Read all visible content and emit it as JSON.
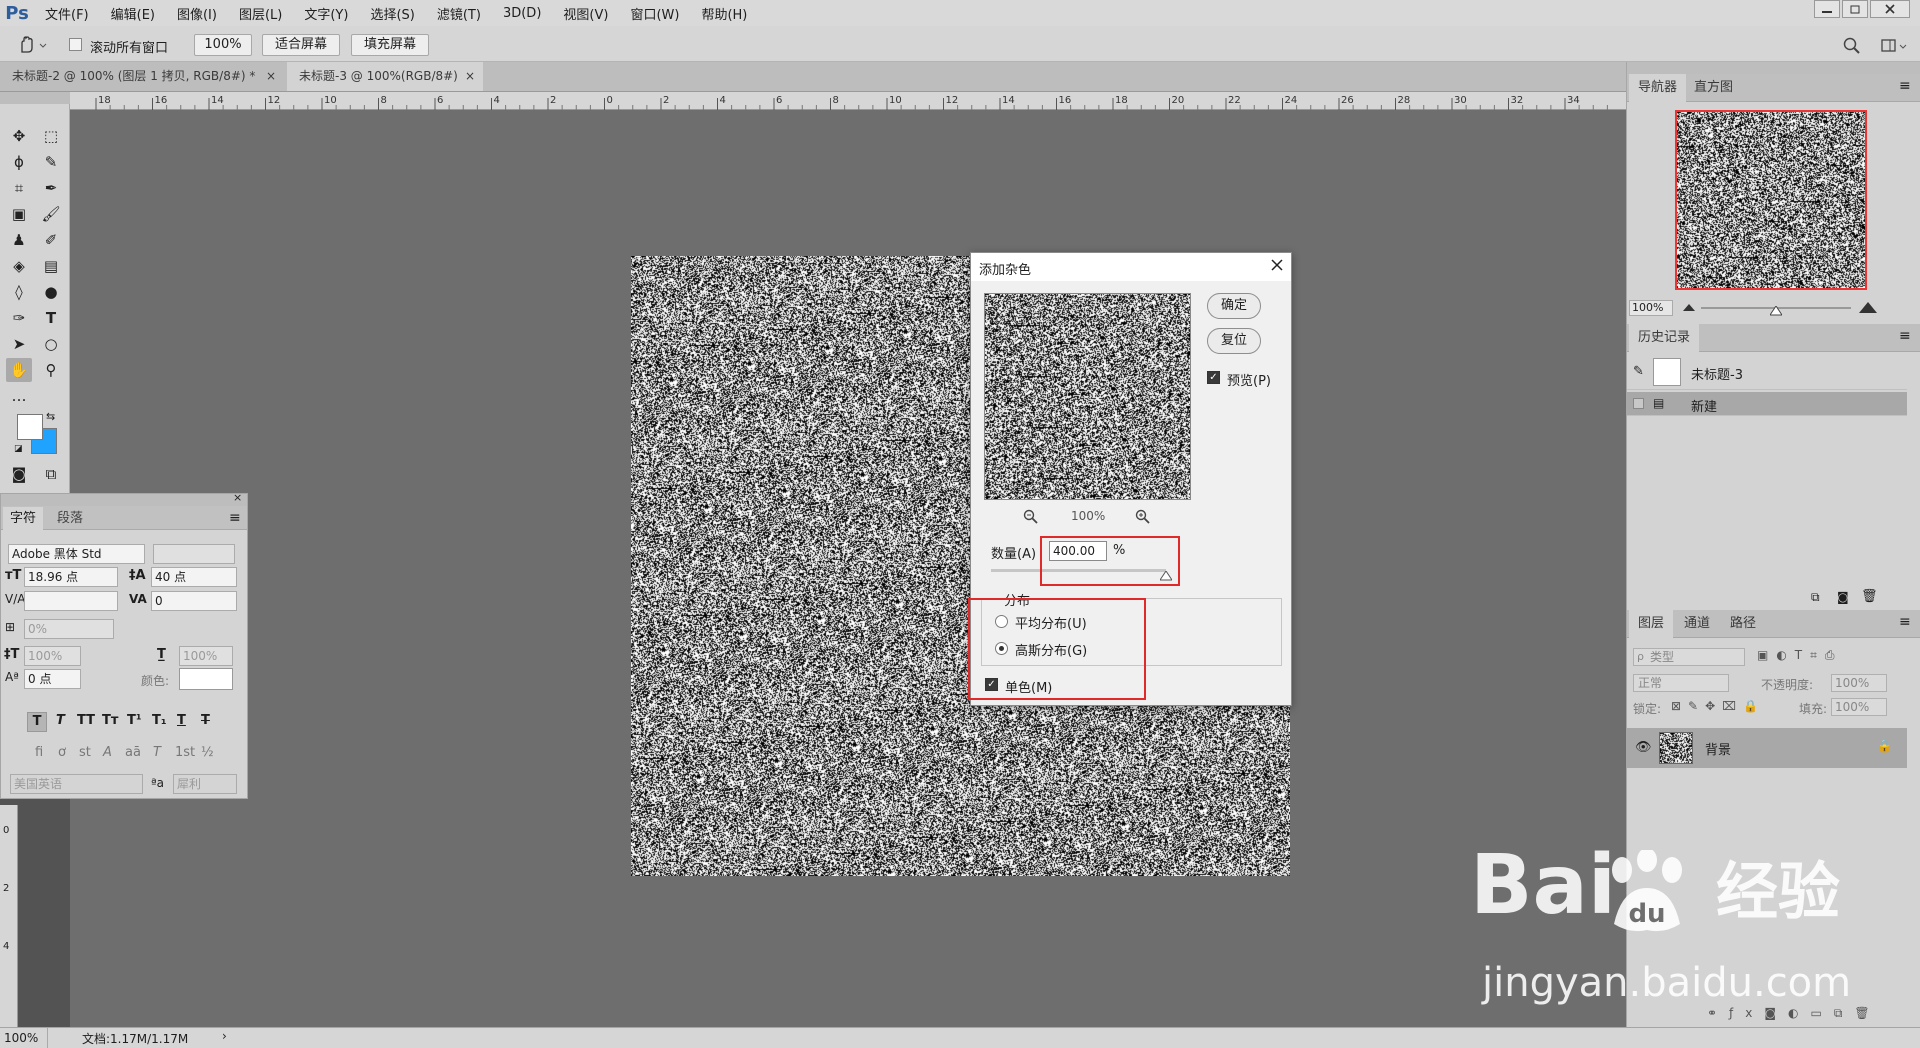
{
  "app": {
    "logo": "Ps"
  },
  "menubar": {
    "items": [
      "文件(F)",
      "编辑(E)",
      "图像(I)",
      "图层(L)",
      "文字(Y)",
      "选择(S)",
      "滤镜(T)",
      "3D(D)",
      "视图(V)",
      "窗口(W)",
      "帮助(H)"
    ]
  },
  "optionsbar": {
    "scroll_all_label": "滚动所有窗口",
    "zoom_value": "100%",
    "fit_screen_label": "适合屏幕",
    "fill_screen_label": "填充屏幕"
  },
  "doctabs": [
    {
      "label": "未标题-2 @ 100% (图层 1 拷贝, RGB/8#) *"
    },
    {
      "label": "未标题-3 @ 100%(RGB/8#)"
    }
  ],
  "ruler": {
    "h_ticks": [
      "18",
      "16",
      "14",
      "12",
      "10",
      "8",
      "6",
      "4",
      "2",
      "0",
      "2",
      "4",
      "6",
      "8",
      "10",
      "12",
      "14",
      "16",
      "18",
      "20",
      "22",
      "24",
      "26",
      "28",
      "30",
      "32",
      "34"
    ],
    "v_ticks": [
      "0",
      "2",
      "4"
    ]
  },
  "charpanel": {
    "tabs": [
      "字符",
      "段落"
    ],
    "font_family": "Adobe 黑体 Std",
    "font_size": "18.96 点",
    "leading": "40 点",
    "tracking": "0",
    "scale_percent": "0%",
    "vscale": "100%",
    "hscale": "100%",
    "baseline": "0 点",
    "color_label": "颜色:",
    "language": "美国英语",
    "aa_label": "ªa",
    "aa_method": "犀利",
    "style_buttons": [
      "T",
      "T",
      "TT",
      "Tт",
      "T¹",
      "T₁",
      "T",
      "T"
    ],
    "opentype_buttons": [
      "fi",
      "ơ",
      "st",
      "A",
      "aā",
      "T",
      "1st",
      "½"
    ]
  },
  "dialog": {
    "title": "添加杂色",
    "ok_label": "确定",
    "reset_label": "复位",
    "preview_label": "预览(P)",
    "preview_checked": true,
    "zoom_value": "100%",
    "amount_label": "数量(A)",
    "amount_value": "400.00",
    "amount_unit": "%",
    "amount_fraction": 1.0,
    "distribution_title": "分布",
    "uniform_label": "平均分布(U)",
    "gaussian_label": "高斯分布(G)",
    "distribution_selected": "gaussian",
    "mono_label": "单色(M)",
    "mono_checked": true
  },
  "navigator": {
    "tabs": [
      "导航器",
      "直方图"
    ],
    "zoom_value": "100%",
    "zoom_fraction": 0.5
  },
  "history": {
    "title": "历史记录",
    "snapshot_label": "未标题-3",
    "steps": [
      "新建"
    ]
  },
  "layers": {
    "tabs": [
      "图层",
      "通道",
      "路径"
    ],
    "filter_placeholder": "类型",
    "blend_mode": "正常",
    "opacity_label": "不透明度:",
    "opacity_value": "100%",
    "lock_label": "锁定:",
    "fill_label": "填充:",
    "fill_value": "100%",
    "items": [
      {
        "name": "背景",
        "locked": true,
        "visible": true
      }
    ]
  },
  "statusbar": {
    "zoom": "100%",
    "doc_info": "文档:1.17M/1.17M"
  },
  "watermark": {
    "brand": "Bai",
    "brand2": "经验",
    "url": "jingyan.baidu.com"
  },
  "colors": {
    "highlight": "#e02a2a",
    "background_swatch": "#1fa3ff",
    "foreground_swatch": "#ffffff"
  }
}
